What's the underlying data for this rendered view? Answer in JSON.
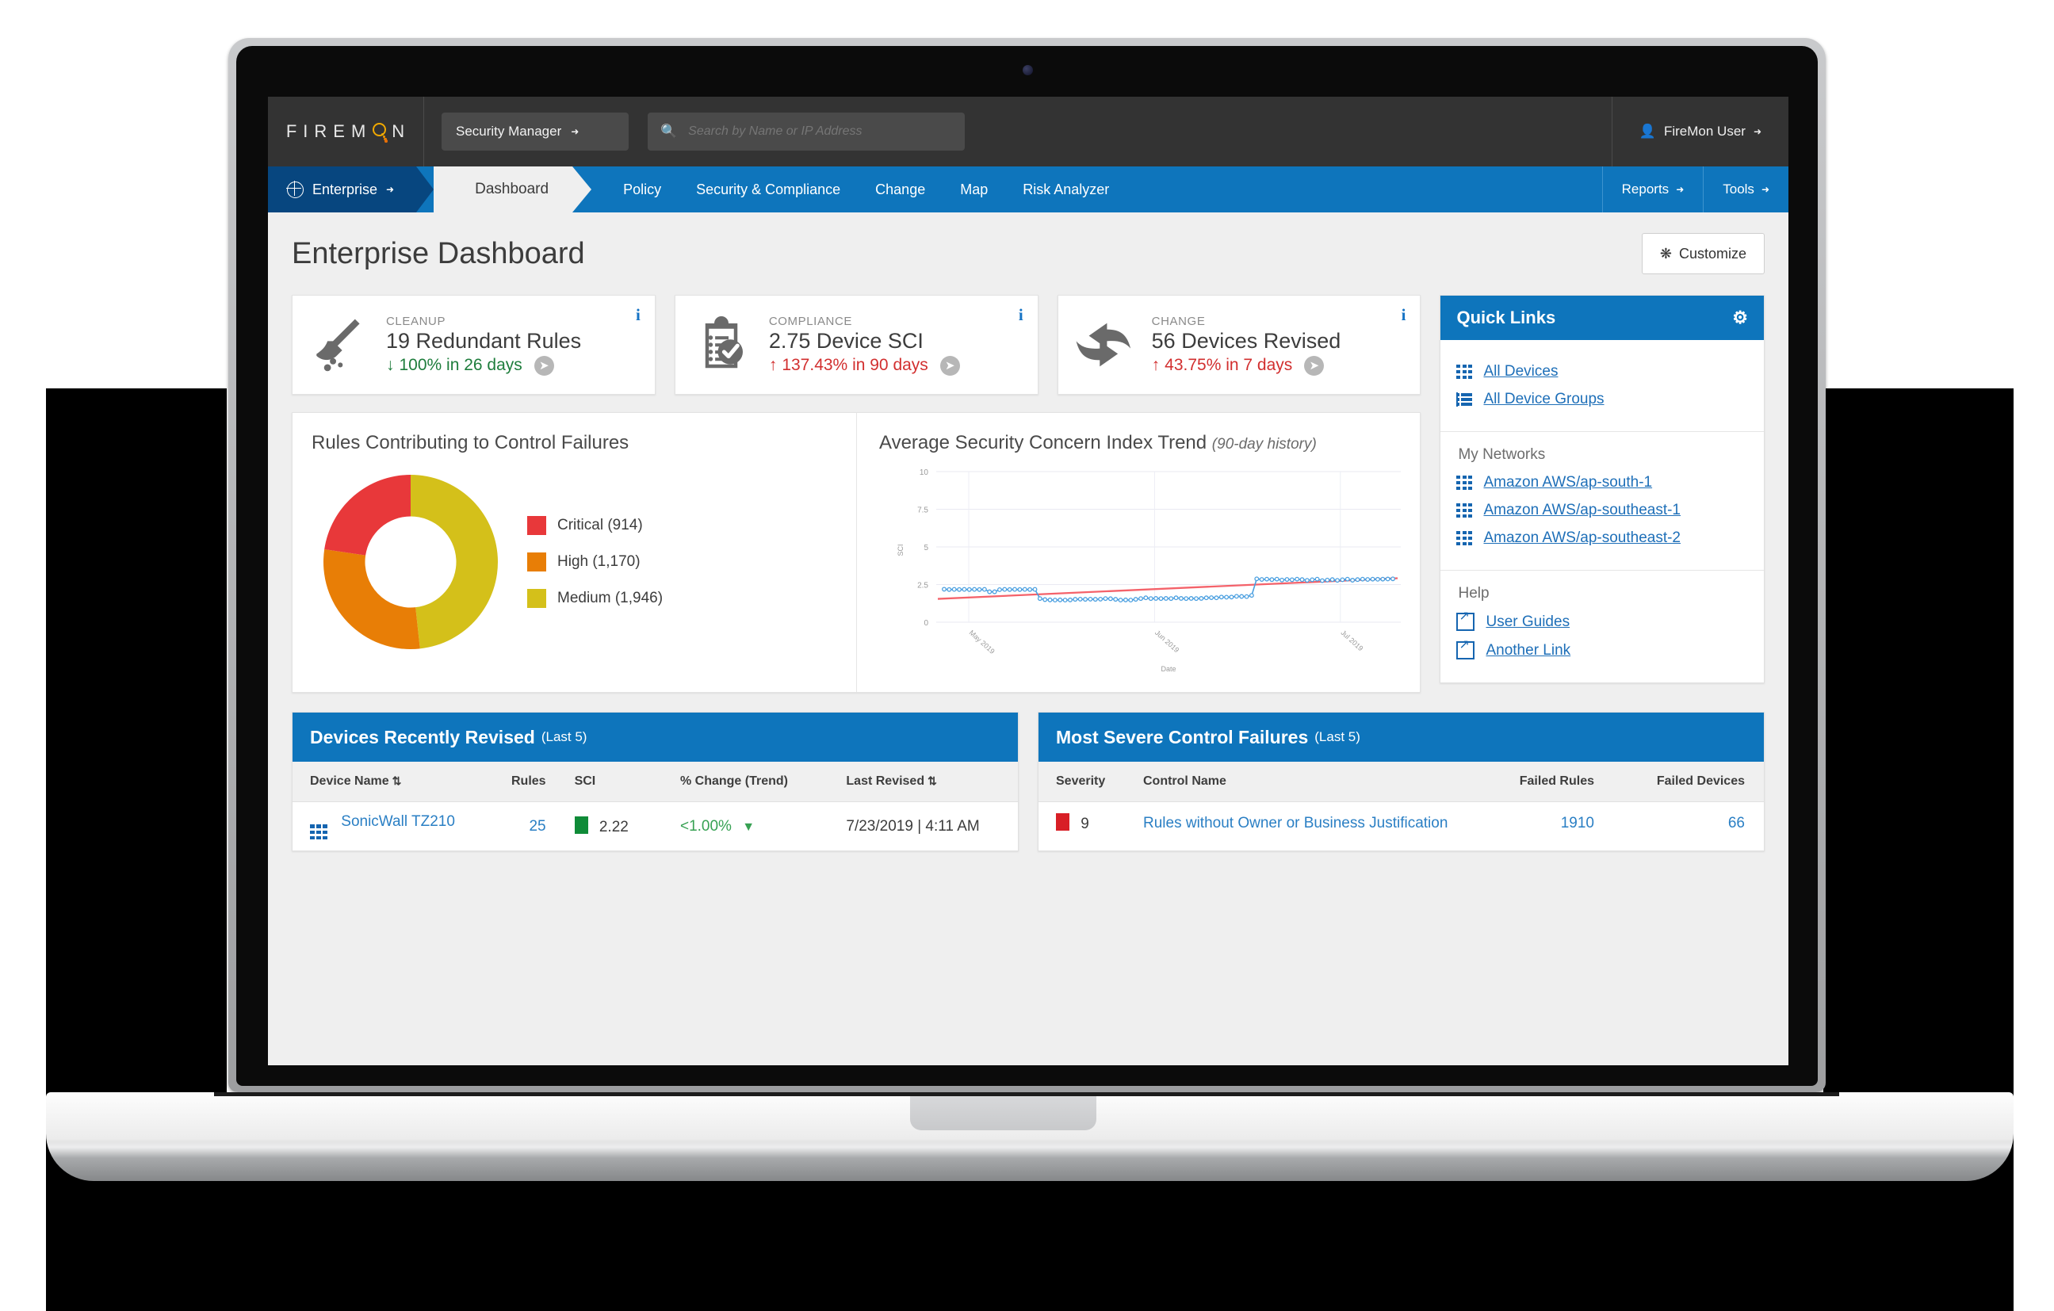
{
  "header": {
    "logo_letters": [
      "F",
      "I",
      "R",
      "E",
      "M",
      "N"
    ],
    "logo_icon": "magnifier-icon",
    "product_selector": "Security Manager",
    "search_placeholder": "Search by Name or IP Address",
    "search_value": "",
    "search_icon": "search-icon",
    "user_label": "FireMon User",
    "user_icon": "person-icon"
  },
  "nav": {
    "scope": "Enterprise",
    "scope_icon": "globe-icon",
    "active_tab": "Dashboard",
    "links": [
      "Policy",
      "Security & Compliance",
      "Change",
      "Map",
      "Risk Analyzer"
    ],
    "right": [
      "Reports",
      "Tools"
    ]
  },
  "page": {
    "title": "Enterprise Dashboard",
    "customize_label": "Customize",
    "customize_icon": "gear-icon"
  },
  "kpis": [
    {
      "category": "CLEANUP",
      "icon": "broom-icon",
      "value": "19 Redundant Rules",
      "delta": "100% in 26 days",
      "direction": "down",
      "direction_arrow": "↓",
      "color": "#1e7d3c",
      "info_icon": "info-icon",
      "go_icon": "arrow-right-circle-icon"
    },
    {
      "category": "COMPLIANCE",
      "icon": "clipboard-check-icon",
      "value": "2.75 Device SCI",
      "delta": "137.43% in 90 days",
      "direction": "up",
      "direction_arrow": "↑",
      "color": "#d22f2f",
      "info_icon": "info-icon",
      "go_icon": "arrow-right-circle-icon"
    },
    {
      "category": "CHANGE",
      "icon": "swap-arrows-icon",
      "value": "56 Devices Revised",
      "delta": "43.75% in 7 days",
      "direction": "up",
      "direction_arrow": "↑",
      "color": "#d22f2f",
      "info_icon": "info-icon",
      "go_icon": "arrow-right-circle-icon"
    }
  ],
  "quick_links": {
    "title": "Quick Links",
    "gear_icon": "gear-icon",
    "top_links": [
      {
        "label": "All Devices",
        "icon": "firewall-icon"
      },
      {
        "label": "All Device Groups",
        "icon": "device-group-icon"
      }
    ],
    "networks_label": "My Networks",
    "networks": [
      {
        "label": "Amazon AWS/ap-south-1",
        "icon": "firewall-icon"
      },
      {
        "label": "Amazon AWS/ap-southeast-1",
        "icon": "firewall-icon"
      },
      {
        "label": "Amazon AWS/ap-southeast-2",
        "icon": "firewall-icon"
      }
    ],
    "help_label": "Help",
    "help_links": [
      {
        "label": "User Guides",
        "icon": "external-link-icon"
      },
      {
        "label": "Another Link",
        "icon": "external-link-icon"
      }
    ]
  },
  "chart_data": [
    {
      "type": "pie",
      "title": "Rules Contributing to Control Failures",
      "subtitle": "",
      "donut": true,
      "labels": [
        "Critical",
        "High",
        "Medium"
      ],
      "values": [
        914,
        1170,
        1946
      ],
      "display_labels": [
        "Critical (914)",
        "High (1,170)",
        "Medium (1,946)"
      ],
      "colors": [
        "#e8383a",
        "#e87e06",
        "#d4c01a"
      ],
      "legend": "right",
      "total": 4030,
      "start_angle_deg": 0,
      "slice_order": [
        "Medium",
        "High",
        "Critical"
      ]
    },
    {
      "type": "line",
      "title": "Average Security Concern Index Trend",
      "subtitle": "(90-day history)",
      "xlabel": "Date",
      "ylabel": "SCI",
      "ylim": [
        0,
        10
      ],
      "yticks": [
        0,
        2.5,
        5,
        7.5,
        10
      ],
      "ytick_labels": [
        "0",
        "2.5",
        "5",
        "7.5",
        "10"
      ],
      "xtick_labels": [
        "May 2019",
        "Jun 2019",
        "Jul 2019"
      ],
      "grid": true,
      "series": [
        {
          "name": "SCI",
          "color": "#4a9fe0",
          "marker": "circle-open",
          "values": [
            2.19,
            2.17,
            2.18,
            2.17,
            2.18,
            2.17,
            2.18,
            2.17,
            2.18,
            2.02,
            2.02,
            2.16,
            2.18,
            2.17,
            2.18,
            2.17,
            2.18,
            2.17,
            2.18,
            1.57,
            1.5,
            1.48,
            1.47,
            1.48,
            1.47,
            1.48,
            1.52,
            1.53,
            1.52,
            1.53,
            1.52,
            1.53,
            1.57,
            1.56,
            1.52,
            1.47,
            1.48,
            1.47,
            1.52,
            1.57,
            1.62,
            1.57,
            1.58,
            1.57,
            1.58,
            1.57,
            1.62,
            1.58,
            1.57,
            1.58,
            1.57,
            1.58,
            1.62,
            1.63,
            1.62,
            1.67,
            1.66,
            1.67,
            1.72,
            1.71,
            1.7,
            1.78,
            2.88,
            2.84,
            2.86,
            2.83,
            2.86,
            2.8,
            2.84,
            2.82,
            2.86,
            2.83,
            2.78,
            2.82,
            2.86,
            2.76,
            2.8,
            2.83,
            2.78,
            2.82,
            2.86,
            2.79,
            2.83,
            2.86,
            2.84,
            2.86,
            2.85,
            2.86,
            2.87,
            2.88
          ]
        },
        {
          "name": "Trend",
          "color": "#f4626a",
          "marker": "none",
          "trendline": true,
          "from": 1.55,
          "to": 2.92
        }
      ]
    }
  ],
  "devices_table": {
    "title": "Devices Recently Revised",
    "count_label": "(Last 5)",
    "columns": [
      "Device Name",
      "Rules",
      "SCI",
      "% Change (Trend)",
      "Last Revised"
    ],
    "sortable": [
      true,
      false,
      false,
      false,
      true
    ],
    "rows": [
      {
        "device": "SonicWall TZ210",
        "device_icon": "firewall-icon",
        "rules": "25",
        "sci": "2.22",
        "sci_color": "#0f8b38",
        "change": "<1.00%",
        "change_dir": "▼",
        "change_color": "#37a153",
        "last_revised": "7/23/2019 | 4:11 AM"
      }
    ]
  },
  "failures_table": {
    "title": "Most Severe Control Failures",
    "count_label": "(Last 5)",
    "columns": [
      "Severity",
      "Control Name",
      "Failed Rules",
      "Failed Devices"
    ],
    "rows": [
      {
        "severity": "9",
        "severity_color": "#d81f26",
        "control": "Rules without Owner or Business Justification",
        "failed_rules": "1910",
        "failed_devices": "66"
      }
    ]
  }
}
